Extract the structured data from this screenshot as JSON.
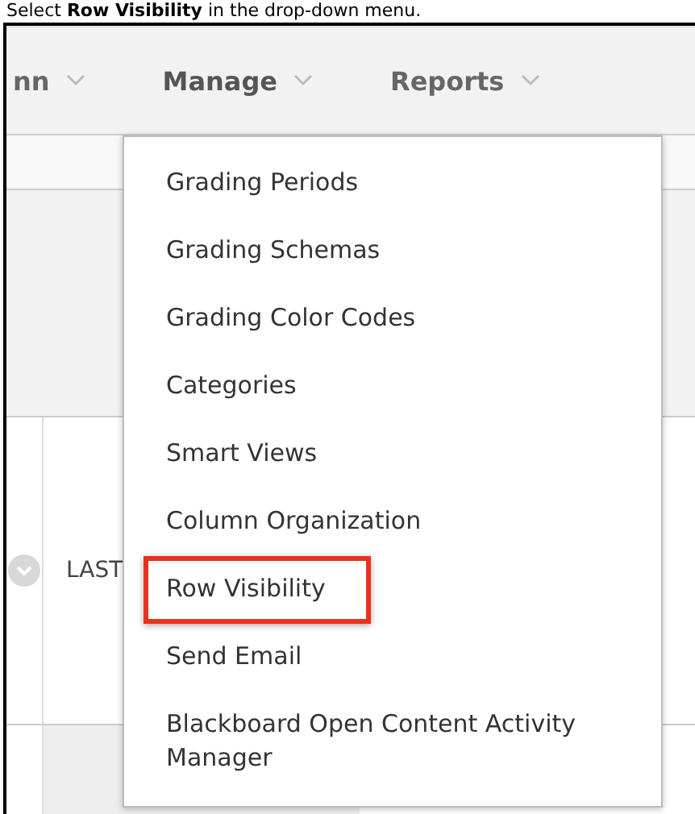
{
  "caption": "Select **Row Visibility** in the drop-down menu.",
  "nav": [
    {
      "label": "nn",
      "selected": false
    },
    {
      "label": "Manage",
      "selected": true
    },
    {
      "label": "Reports",
      "selected": false
    }
  ],
  "table": {
    "header_cell": "LAST"
  },
  "menu": [
    {
      "label": "Grading Periods",
      "selected": false
    },
    {
      "label": "Grading Schemas",
      "selected": false
    },
    {
      "label": "Grading Color Codes",
      "selected": false
    },
    {
      "label": "Categories",
      "selected": false
    },
    {
      "label": "Smart Views",
      "selected": false
    },
    {
      "label": "Column Organization",
      "selected": false
    },
    {
      "label": "Row Visibility",
      "selected": true
    },
    {
      "label": "Send Email",
      "selected": false
    },
    {
      "label": "Blackboard Open Content Activity Manager",
      "selected": false
    }
  ]
}
